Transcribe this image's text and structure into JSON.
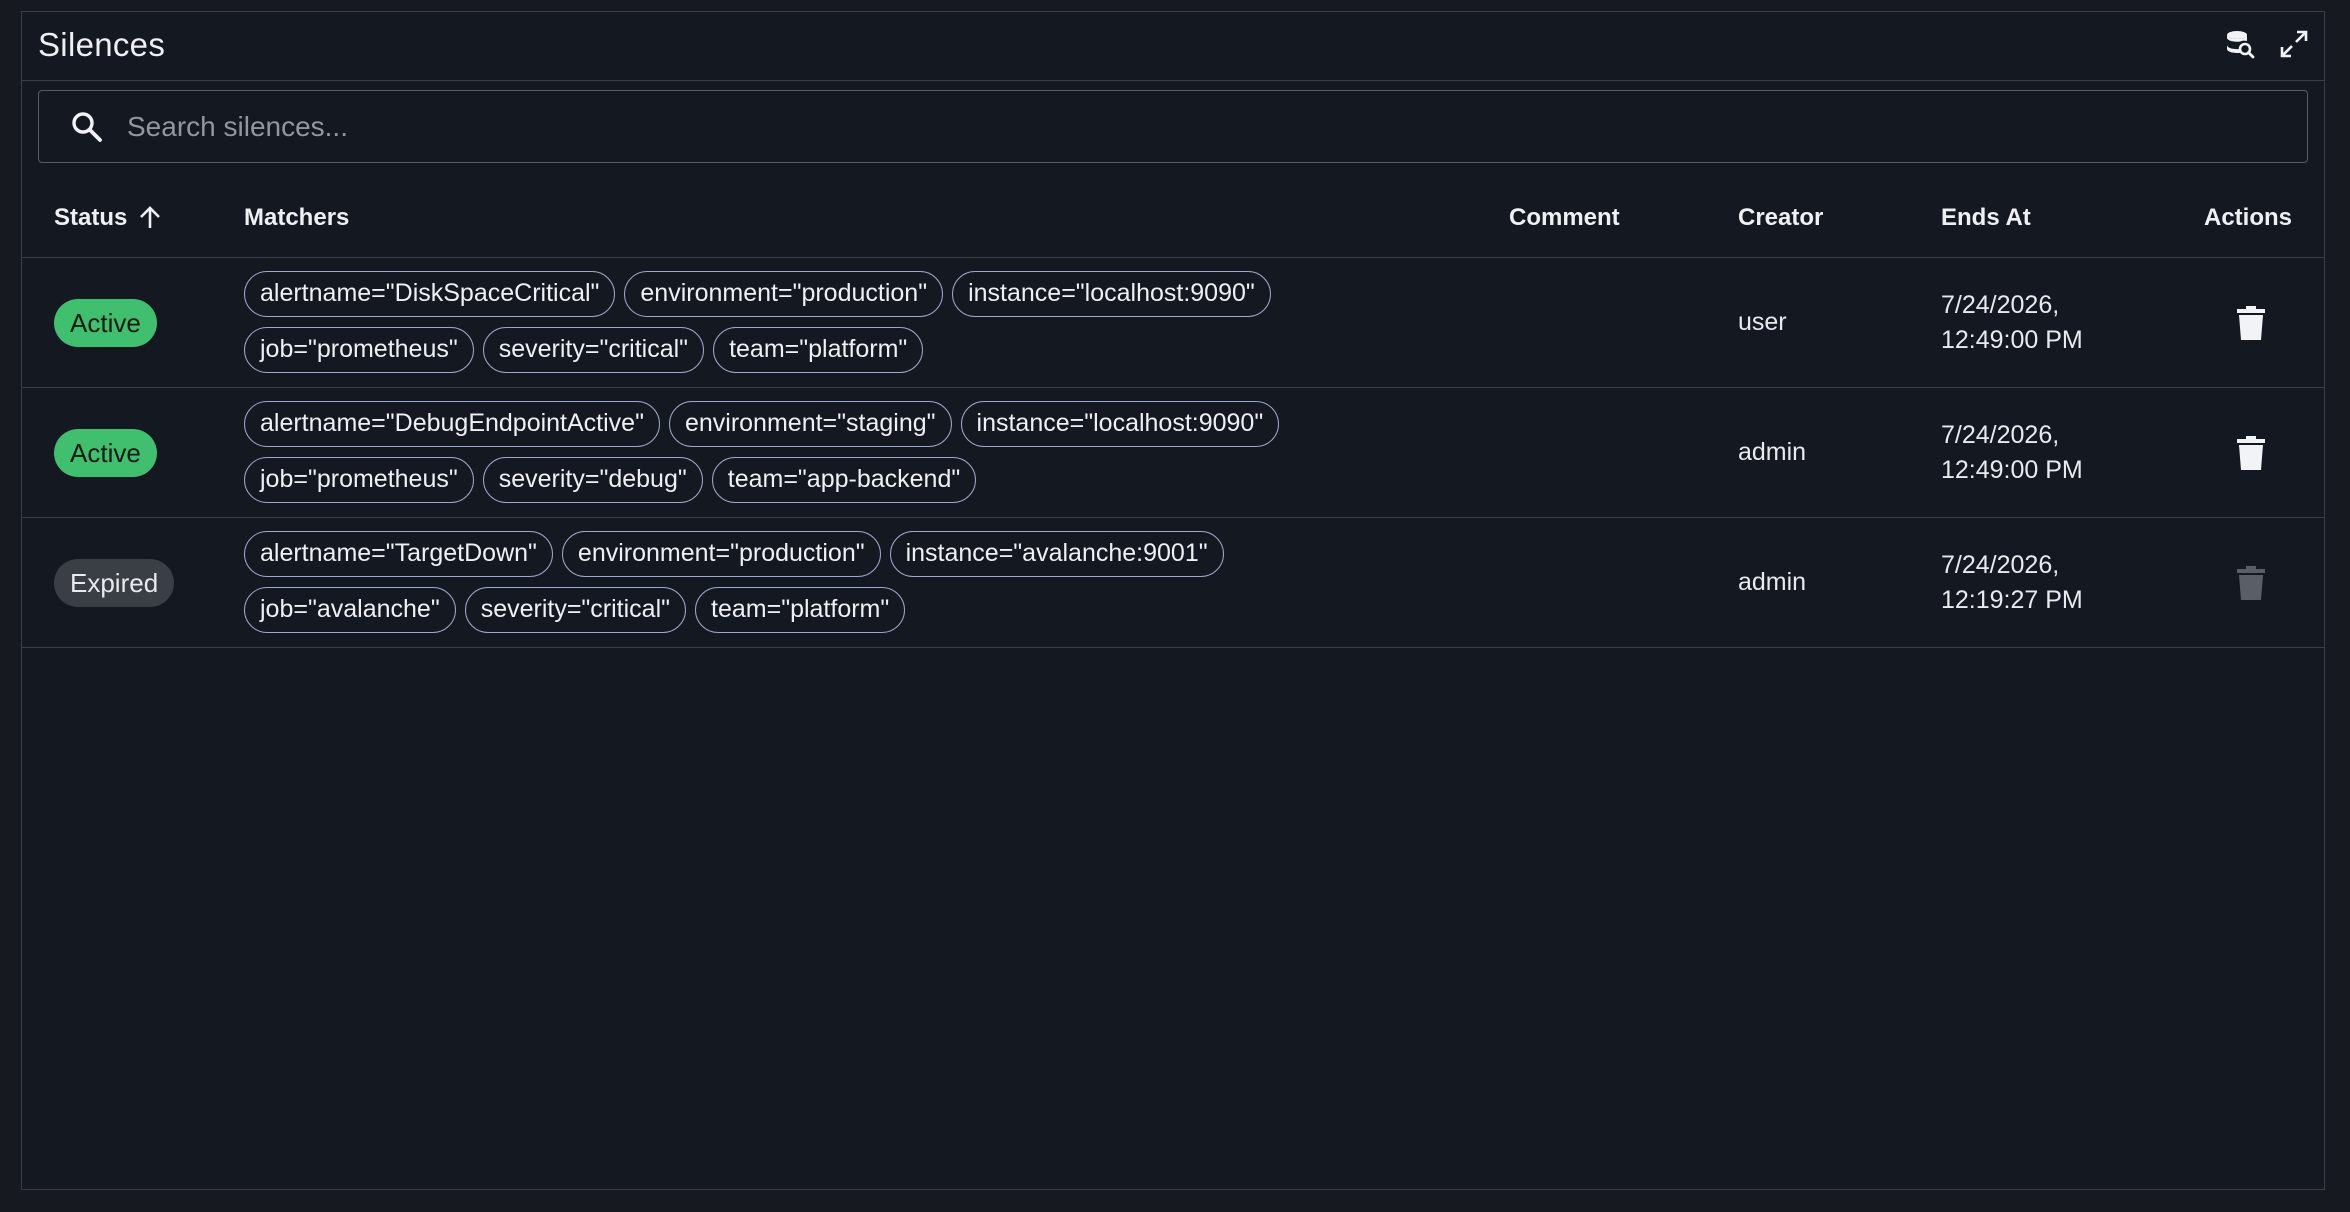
{
  "panel": {
    "title": "Silences",
    "icons": [
      "database-search-icon",
      "expand-icon"
    ]
  },
  "search": {
    "placeholder": "Search silences...",
    "value": ""
  },
  "table": {
    "columns": {
      "status": "Status",
      "matchers": "Matchers",
      "comment": "Comment",
      "creator": "Creator",
      "ends_at": "Ends At",
      "actions": "Actions"
    },
    "sort": {
      "column": "status",
      "direction": "ascending",
      "icon": "arrow-up-icon"
    },
    "rows": [
      {
        "status": "Active",
        "status_color": "#40bf6f",
        "matchers": [
          "alertname=\"DiskSpaceCritical\"",
          "environment=\"production\"",
          "instance=\"localhost:9090\"",
          "job=\"prometheus\"",
          "severity=\"critical\"",
          "team=\"platform\""
        ],
        "comment": "",
        "creator": "user",
        "ends_at_date": "7/24/2026,",
        "ends_at_time": "12:49:00 PM",
        "delete_enabled": true
      },
      {
        "status": "Active",
        "status_color": "#40bf6f",
        "matchers": [
          "alertname=\"DebugEndpointActive\"",
          "environment=\"staging\"",
          "instance=\"localhost:9090\"",
          "job=\"prometheus\"",
          "severity=\"debug\"",
          "team=\"app-backend\""
        ],
        "comment": "",
        "creator": "admin",
        "ends_at_date": "7/24/2026,",
        "ends_at_time": "12:49:00 PM",
        "delete_enabled": true
      },
      {
        "status": "Expired",
        "status_color": "#3a3e45",
        "matchers": [
          "alertname=\"TargetDown\"",
          "environment=\"production\"",
          "instance=\"avalanche:9001\"",
          "job=\"avalanche\"",
          "severity=\"critical\"",
          "team=\"platform\""
        ],
        "comment": "",
        "creator": "admin",
        "ends_at_date": "7/24/2026,",
        "ends_at_time": "12:19:27 PM",
        "delete_enabled": false
      }
    ]
  }
}
